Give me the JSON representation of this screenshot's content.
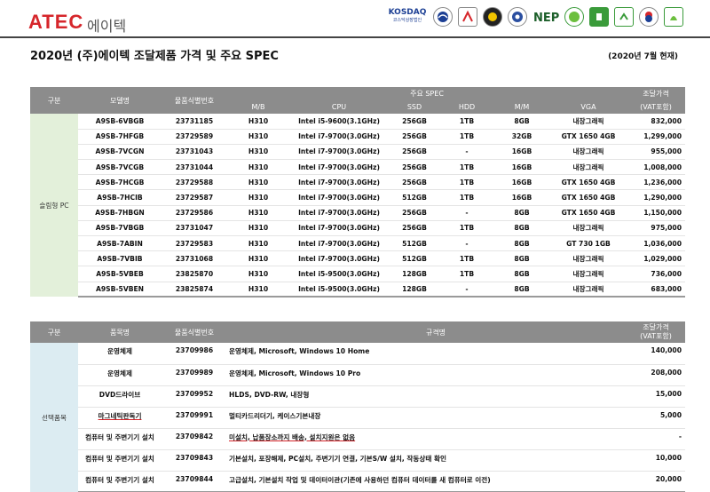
{
  "header": {
    "logo": "ATEC",
    "logo_sub": "에이텍",
    "certs": [
      {
        "icon": "kosdaq-logo",
        "label": "KOSDAQ",
        "sub": "코스닥상장법인"
      },
      {
        "icon": "cert-mark-1"
      },
      {
        "icon": "cert-mark-2"
      },
      {
        "icon": "cert-mark-3"
      },
      {
        "icon": "cert-mark-4"
      },
      {
        "icon": "cert-mark-5"
      },
      {
        "icon": "cert-mark-6"
      },
      {
        "icon": "cert-mark-7"
      },
      {
        "icon": "cert-mark-8"
      },
      {
        "icon": "cert-mark-9"
      }
    ]
  },
  "title": "2020년 (주)에이텍 조달제품 가격 및 주요 SPEC",
  "date": "(2020년 7월 현재)",
  "table1": {
    "headers": {
      "category": "구분",
      "model": "모델명",
      "item_id": "물품식별번호",
      "spec": "주요 SPEC",
      "mb": "M/B",
      "cpu": "CPU",
      "ssd": "SSD",
      "hdd": "HDD",
      "mm": "M/M",
      "vga": "VGA",
      "price": "조달가격",
      "price_sub": "(VAT포함)"
    },
    "category": "슬림형 PC",
    "rows": [
      {
        "model": "A9SB-6VBGB",
        "id": "23731185",
        "mb": "H310",
        "cpu": "Intel i5-9600(3.1GHz)",
        "ssd": "256GB",
        "hdd": "1TB",
        "mm": "8GB",
        "vga": "내장그래픽",
        "price": "832,000"
      },
      {
        "model": "A9SB-7HFGB",
        "id": "23729589",
        "mb": "H310",
        "cpu": "Intel i7-9700(3.0GHz)",
        "ssd": "256GB",
        "hdd": "1TB",
        "mm": "32GB",
        "vga": "GTX 1650 4GB",
        "price": "1,299,000"
      },
      {
        "model": "A9SB-7VCGN",
        "id": "23731043",
        "mb": "H310",
        "cpu": "Intel i7-9700(3.0GHz)",
        "ssd": "256GB",
        "hdd": "-",
        "mm": "16GB",
        "vga": "내장그래픽",
        "price": "955,000"
      },
      {
        "model": "A9SB-7VCGB",
        "id": "23731044",
        "mb": "H310",
        "cpu": "Intel i7-9700(3.0GHz)",
        "ssd": "256GB",
        "hdd": "1TB",
        "mm": "16GB",
        "vga": "내장그래픽",
        "price": "1,008,000"
      },
      {
        "model": "A9SB-7HCGB",
        "id": "23729588",
        "mb": "H310",
        "cpu": "Intel i7-9700(3.0GHz)",
        "ssd": "256GB",
        "hdd": "1TB",
        "mm": "16GB",
        "vga": "GTX 1650 4GB",
        "price": "1,236,000"
      },
      {
        "model": "A9SB-7HCIB",
        "id": "23729587",
        "mb": "H310",
        "cpu": "Intel i7-9700(3.0GHz)",
        "ssd": "512GB",
        "hdd": "1TB",
        "mm": "16GB",
        "vga": "GTX 1650 4GB",
        "price": "1,290,000"
      },
      {
        "model": "A9SB-7HBGN",
        "id": "23729586",
        "mb": "H310",
        "cpu": "Intel i7-9700(3.0GHz)",
        "ssd": "256GB",
        "hdd": "-",
        "mm": "8GB",
        "vga": "GTX 1650 4GB",
        "price": "1,150,000"
      },
      {
        "model": "A9SB-7VBGB",
        "id": "23731047",
        "mb": "H310",
        "cpu": "Intel i7-9700(3.0GHz)",
        "ssd": "256GB",
        "hdd": "1TB",
        "mm": "8GB",
        "vga": "내장그래픽",
        "price": "975,000"
      },
      {
        "model": "A9SB-7ABIN",
        "id": "23729583",
        "mb": "H310",
        "cpu": "Intel i7-9700(3.0GHz)",
        "ssd": "512GB",
        "hdd": "-",
        "mm": "8GB",
        "vga": "GT 730 1GB",
        "price": "1,036,000"
      },
      {
        "model": "A9SB-7VBIB",
        "id": "23731068",
        "mb": "H310",
        "cpu": "Intel i7-9700(3.0GHz)",
        "ssd": "512GB",
        "hdd": "1TB",
        "mm": "8GB",
        "vga": "내장그래픽",
        "price": "1,029,000"
      },
      {
        "model": "A9SB-5VBEB",
        "id": "23825870",
        "mb": "H310",
        "cpu": "Intel i5-9500(3.0GHz)",
        "ssd": "128GB",
        "hdd": "1TB",
        "mm": "8GB",
        "vga": "내장그래픽",
        "price": "736,000"
      },
      {
        "model": "A9SB-5VBEN",
        "id": "23825874",
        "mb": "H310",
        "cpu": "Intel i5-9500(3.0GHz)",
        "ssd": "128GB",
        "hdd": "-",
        "mm": "8GB",
        "vga": "내장그래픽",
        "price": "683,000"
      }
    ]
  },
  "table2": {
    "headers": {
      "category": "구분",
      "name": "품목명",
      "item_id": "물품식별번호",
      "spec": "규격명",
      "price": "조달가격",
      "price_sub": "(VAT포함)"
    },
    "category": "선택품목",
    "rows": [
      {
        "name": "운영체제",
        "id": "23709986",
        "spec": "운영체제, Microsoft, Windows 10 Home",
        "price": "140,000"
      },
      {
        "name": "운영체제",
        "id": "23709989",
        "spec": "운영체제, Microsoft, Windows 10 Pro",
        "price": "208,000"
      },
      {
        "name": "DVD드라이브",
        "id": "23709952",
        "spec": "HLDS, DVD-RW, 내장형",
        "price": "15,000"
      },
      {
        "name": "마그네틱판독기",
        "id": "23709991",
        "spec": "멀티카드리더기, 케이스기본내장",
        "price": "5,000"
      },
      {
        "name": "컴퓨터 및 주변기기 설치",
        "id": "23709842",
        "spec": "미설치, 납품장소까지 배송, 설치지원은 없음",
        "price": "-"
      },
      {
        "name": "컴퓨터 및 주변기기 설치",
        "id": "23709843",
        "spec": "기본설치, 포장해제, PC설치, 주변기기 연결, 기본S/W 설치, 작동상태 확인",
        "price": "10,000"
      },
      {
        "name": "컴퓨터 및 주변기기 설치",
        "id": "23709844",
        "spec": "고급설치, 기본설치 작업 및 데이터이관(기존에 사용하던 컴퓨터 데이터를 새 컴퓨터로 이전)",
        "price": "20,000"
      }
    ]
  }
}
